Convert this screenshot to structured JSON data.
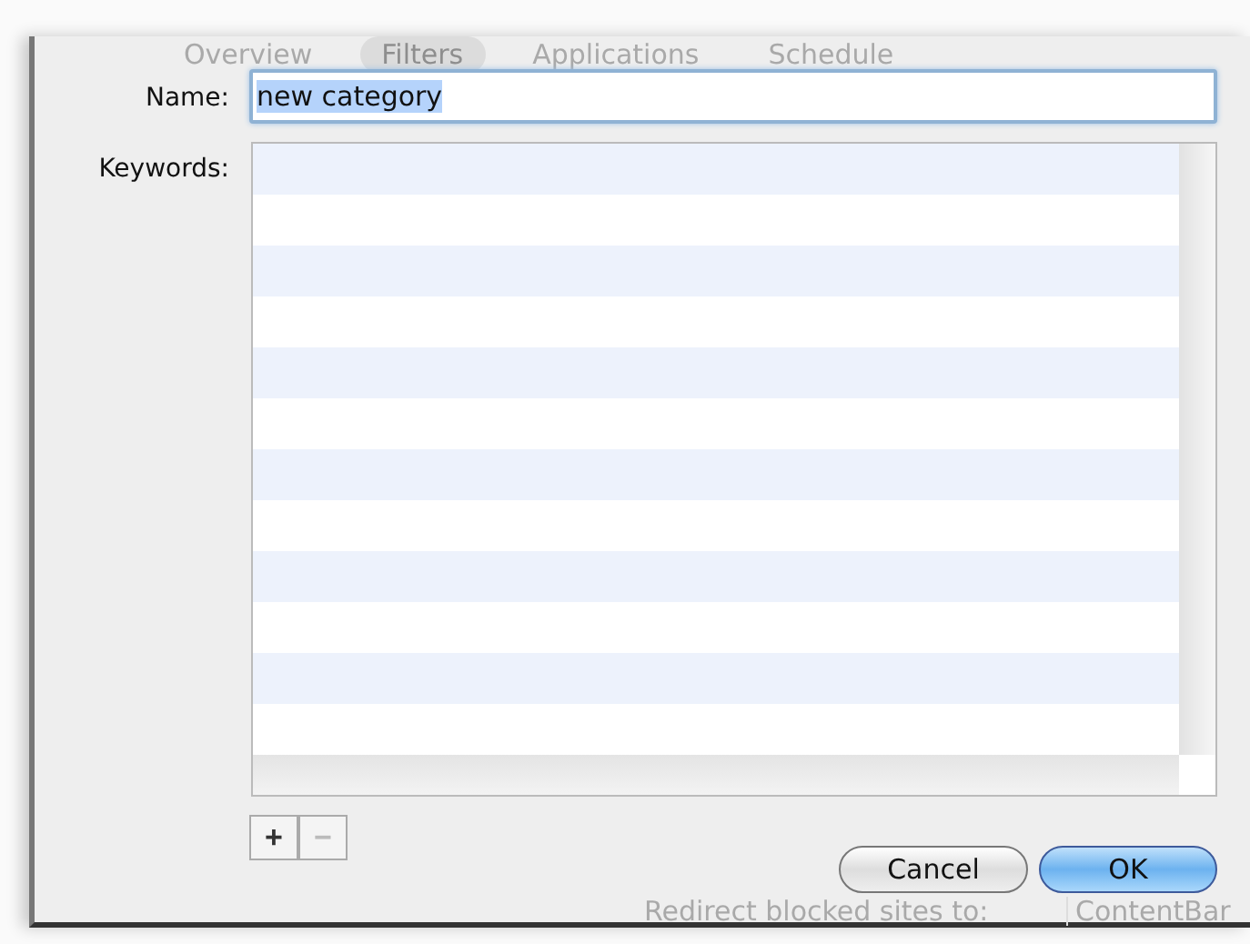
{
  "background_window": {
    "tabs": [
      {
        "label": "Overview",
        "selected": false
      },
      {
        "label": "Filters",
        "selected": true
      },
      {
        "label": "Applications",
        "selected": false
      },
      {
        "label": "Schedule",
        "selected": false
      }
    ],
    "redirect_label": "Redirect blocked sites to:",
    "redirect_value": "ContentBar"
  },
  "sheet": {
    "name_label": "Name:",
    "name_value": "new category",
    "name_text_selected": true,
    "keywords_label": "Keywords:",
    "list_buttons": [
      {
        "label": "+",
        "disabled": false
      },
      {
        "label": "−",
        "disabled": true
      }
    ],
    "buttons": [
      {
        "label": "Cancel",
        "default": false
      },
      {
        "label": "OK",
        "default": true
      }
    ]
  }
}
